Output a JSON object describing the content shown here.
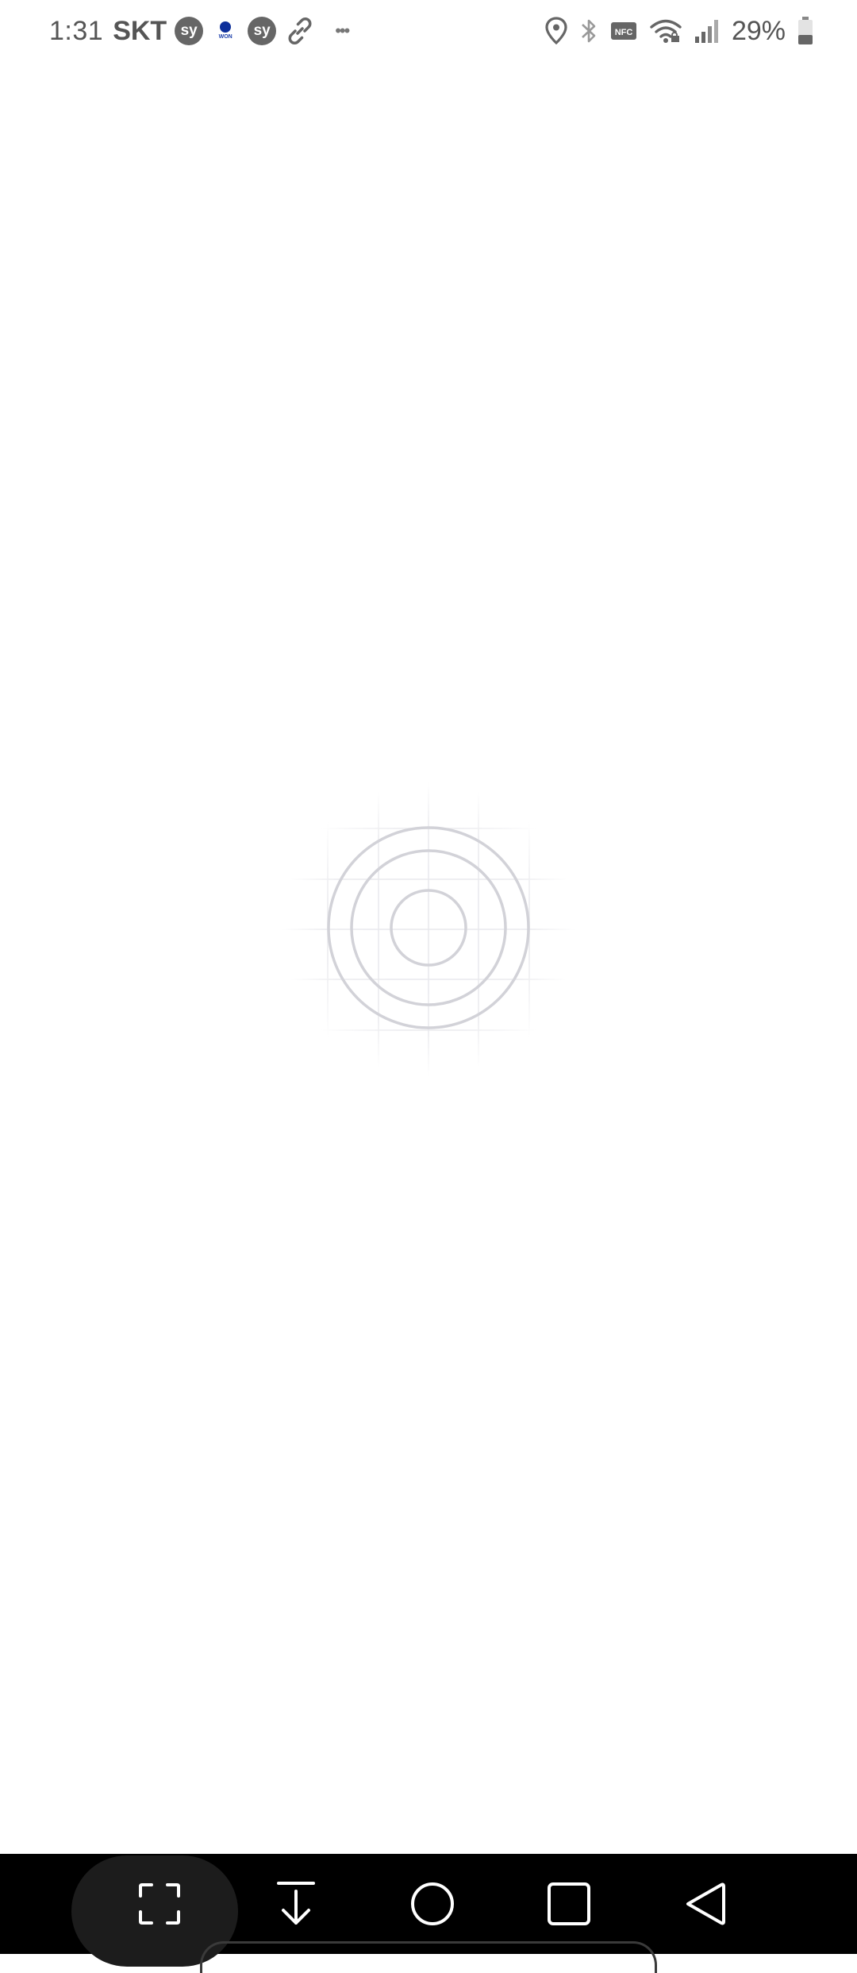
{
  "status_bar": {
    "time": "1:31",
    "carrier": "SKT",
    "notification_badge_1": "sy",
    "notification_badge_2": "sy",
    "won_badge_text": "WON",
    "battery_percent": "29%",
    "icons": {
      "won": "won-app-icon",
      "link": "link-icon",
      "more": "more-dots-icon",
      "location": "location-pin-icon",
      "bluetooth": "bluetooth-icon",
      "nfc": "nfc-icon",
      "wifi": "wifi-icon",
      "signal": "cell-signal-icon",
      "battery": "battery-icon"
    }
  },
  "loader": {
    "icon": "target-rings-loading-icon"
  },
  "nav_bar": {
    "buttons": [
      {
        "name": "screenshot-capture-button",
        "icon": "capture-frame-icon"
      },
      {
        "name": "download-button",
        "icon": "arrow-down-icon"
      },
      {
        "name": "home-button",
        "icon": "circle-home-icon"
      },
      {
        "name": "recents-button",
        "icon": "square-recents-icon"
      },
      {
        "name": "back-button",
        "icon": "triangle-back-icon"
      }
    ]
  },
  "colors": {
    "background": "#ffffff",
    "status_text": "#555555",
    "nav_background": "#000000",
    "nav_icon": "#ffffff",
    "loader_ring": "#d2d2d8",
    "loader_grid": "#ececf0"
  }
}
